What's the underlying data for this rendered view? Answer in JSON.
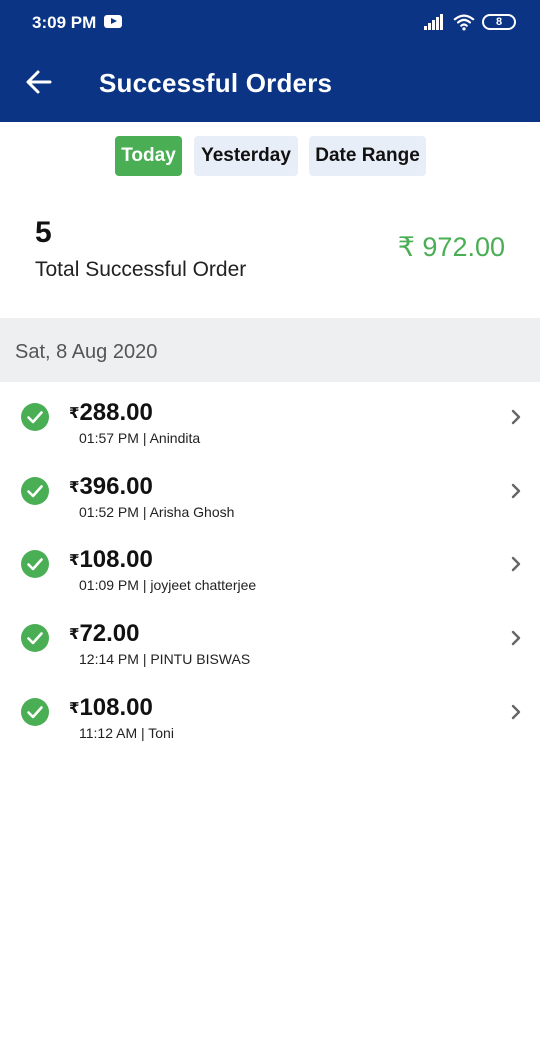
{
  "status": {
    "time": "3:09 PM",
    "battery": "8"
  },
  "header": {
    "title": "Successful Orders"
  },
  "tabs": [
    {
      "label": "Today",
      "active": true
    },
    {
      "label": "Yesterday",
      "active": false
    },
    {
      "label": "Date Range",
      "active": false
    }
  ],
  "summary": {
    "count": "5",
    "label": "Total Successful Order",
    "amount": "₹ 972.00"
  },
  "date_group": "Sat, 8 Aug 2020",
  "currency_symbol": "₹",
  "orders": [
    {
      "amount": "288.00",
      "meta": "01:57 PM | Anindita"
    },
    {
      "amount": "396.00",
      "meta": "01:52 PM | Arisha Ghosh"
    },
    {
      "amount": "108.00",
      "meta": "01:09 PM | joyjeet chatterjee"
    },
    {
      "amount": "72.00",
      "meta": "12:14 PM | PINTU BISWAS"
    },
    {
      "amount": "108.00",
      "meta": "11:12 AM | Toni"
    }
  ],
  "colors": {
    "appbar": "#0b3484",
    "accent_green": "#4aae54",
    "tab_inactive": "#e8eef8",
    "date_header_bg": "#eeeff1"
  }
}
